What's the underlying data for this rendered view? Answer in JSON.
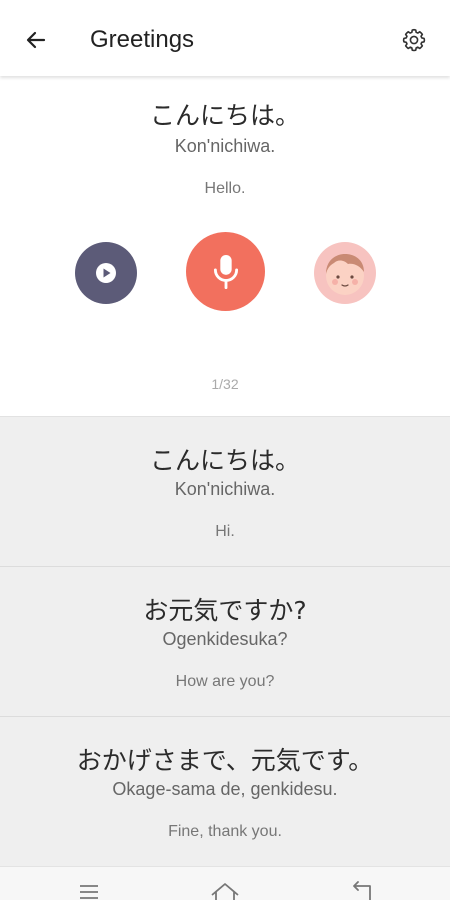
{
  "header": {
    "title": "Greetings",
    "back_icon": "arrow-left-icon",
    "settings_icon": "gear-icon"
  },
  "current": {
    "japanese": "こんにちは。",
    "romaji": "Kon'nichiwa.",
    "english": "Hello.",
    "counter": "1/32",
    "play_icon": "play-icon",
    "mic_icon": "microphone-icon",
    "avatar_icon": "child-face-icon"
  },
  "phrases": [
    {
      "japanese": "こんにちは。",
      "romaji": "Kon'nichiwa.",
      "english": "Hi."
    },
    {
      "japanese": "お元気ですか?",
      "romaji": "Ogenkidesuka?",
      "english": "How are you?"
    },
    {
      "japanese": "おかげさまで、元気です。",
      "romaji": "Okage-sama de, genkidesu.",
      "english": "Fine, thank you."
    }
  ],
  "nav": {
    "menu_icon": "menu-icon",
    "home_icon": "home-icon",
    "back_icon": "nav-back-icon"
  },
  "colors": {
    "play": "#5c5b78",
    "mic": "#f2705e",
    "avatar_bg": "#f7c3c0",
    "list_bg": "#efefef"
  }
}
